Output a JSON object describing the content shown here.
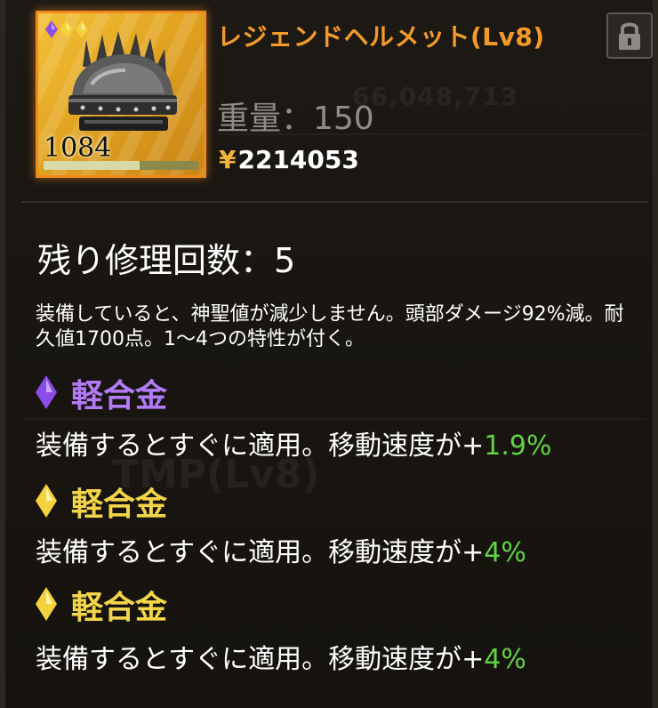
{
  "item": {
    "name": "レジェンドヘルメット(Lv8)",
    "count": "1084",
    "durability_fraction": 0.62,
    "rarity_gems": [
      "purple",
      "gold",
      "gold"
    ],
    "weight_text": "重量：150",
    "currency_symbol": "¥",
    "price": "2214053",
    "remaining_repairs": "残り修理回数：5",
    "description": "装備していると、神聖値が減少しません。頭部ダメージ92%減。耐久値1700点。1〜4つの特性が付く。"
  },
  "traits": [
    {
      "name": "軽合金",
      "gem_color": "#9a5cf0",
      "text": "装備するとすぐに適用。移動速度が+",
      "value": "1.9%"
    },
    {
      "name": "軽合金",
      "gem_color": "#f2cf3c",
      "text": "装備するとすぐに適用。移動速度が+",
      "value": "4%"
    },
    {
      "name": "軽合金",
      "gem_color": "#f2cf3c",
      "text": "装備するとすぐに適用。移動速度が+",
      "value": "4%"
    }
  ],
  "colors": {
    "title": "#f39a2a",
    "trait_purple": "#b27af5",
    "trait_gold": "#f3d54a",
    "value_green": "#62d144",
    "frame_orange": "#f08a1c"
  },
  "icons": {
    "lock": "lock-icon",
    "helmet": "helmet-icon",
    "gem": "diamond-gem-icon"
  }
}
